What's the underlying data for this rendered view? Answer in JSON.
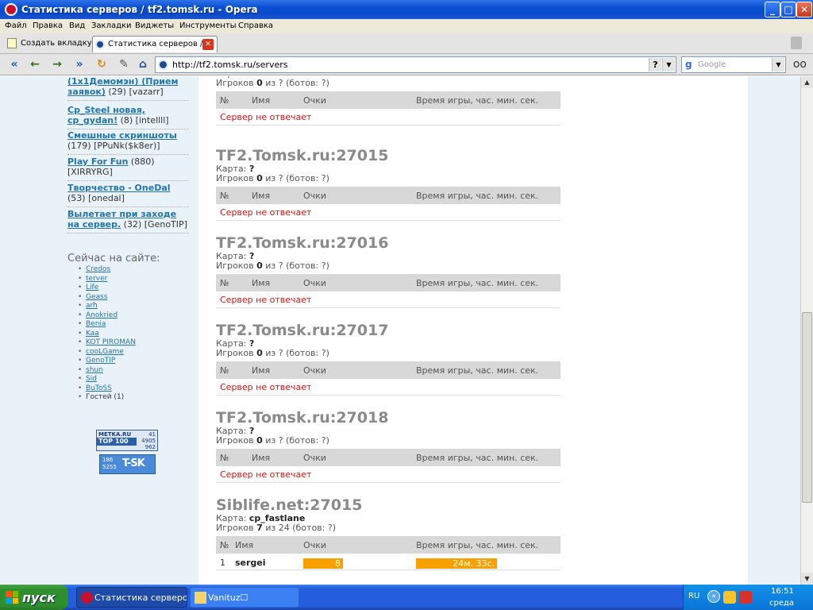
{
  "window": {
    "title": "Статистика серверов / tf2.tomsk.ru - Opera",
    "buttons": {
      "minimize": "_",
      "maximize": "□",
      "close": "✕"
    }
  },
  "menu": [
    "Файл",
    "Правка",
    "Вид",
    "Закладки",
    "Виджеты",
    "Инструменты",
    "Справка"
  ],
  "tabs": {
    "new_tab": "Создать вкладку",
    "active_tab": "Статистика серверов / ...",
    "close_glyph": "✕"
  },
  "toolbar": {
    "url": "http://tf2.tomsk.ru/servers",
    "search_engine": "Google",
    "search_glyph": "g",
    "info_glyph": "?",
    "dropdown_glyph": "▼",
    "glasses_glyph": "oo",
    "nav_glyphs": {
      "rewind": "«",
      "back": "←",
      "forward": "→",
      "fast_forward": "»",
      "reload": "↻",
      "edit": "✎",
      "home": "⌂"
    }
  },
  "sidebar": {
    "forum_items": [
      {
        "title": "(1х1Демомэн) (Прием заявок)",
        "meta": " (29) [vazarr]"
      },
      {
        "title": "Cp_Steel новая, cp_gydan!",
        "meta": " (8) [intellll]"
      },
      {
        "title": "Смешные скриншоты",
        "meta": " (179) [PPuNk($k8er)]"
      },
      {
        "title": "Play For Fun",
        "meta": " (880) [XIRRYRG]"
      },
      {
        "title": "Творчество - OneDal",
        "meta": " (53) [onedal]"
      },
      {
        "title": "Вылетает при заходе на сервер.",
        "meta": " (32) [GenoTIP]"
      }
    ],
    "online_title": "Сейчас на сайте:",
    "online_users": [
      "Credos",
      "terver",
      "Life",
      "Geass",
      "arh",
      "Anokried",
      "Benia",
      "Kaa",
      "KOT PIROMAN",
      "cooLGame",
      "GenoTIP",
      "shun",
      "Sid",
      "BuToSS"
    ],
    "guests": "Гостей (1)",
    "counter1": {
      "site": "METKA.RU",
      "label": "TOP 100",
      "n1": "41",
      "n2": "4905",
      "n3": "962"
    },
    "counter2": {
      "n1": "186",
      "n2": "5255",
      "logo": "T-SK"
    }
  },
  "table_headers": {
    "num": "№",
    "name": "Имя",
    "score": "Очки",
    "time": "Время игры, час. мин. сек."
  },
  "labels": {
    "map": "Карта:",
    "players": "Игроков",
    "of": "из",
    "bots_open": "(ботов:",
    "bots_close": ")"
  },
  "servers": [
    {
      "name": "",
      "map": "?",
      "players": "0",
      "max": "?",
      "bots": "?",
      "status": "Сервер не отвечает"
    },
    {
      "name": "TF2.Tomsk.ru:27015",
      "map": "?",
      "players": "0",
      "max": "?",
      "bots": "?",
      "status": "Сервер не отвечает"
    },
    {
      "name": "TF2.Tomsk.ru:27016",
      "map": "?",
      "players": "0",
      "max": "?",
      "bots": "?",
      "status": "Сервер не отвечает"
    },
    {
      "name": "TF2.Tomsk.ru:27017",
      "map": "?",
      "players": "0",
      "max": "?",
      "bots": "?",
      "status": "Сервер не отвечает"
    },
    {
      "name": "TF2.Tomsk.ru:27018",
      "map": "?",
      "players": "0",
      "max": "?",
      "bots": "?",
      "status": "Сервер не отвечает"
    },
    {
      "name": "Siblife.net:27015",
      "map": "cp_fastlane",
      "players": "7",
      "max": "24",
      "bots": "?",
      "status": ""
    }
  ],
  "siblife_players": [
    {
      "num": "1",
      "name": "sergei",
      "score": "8",
      "time": "24м. 33с."
    }
  ],
  "taskbar": {
    "start": "пуск",
    "items": [
      "Статистика серверов...",
      "Vanituz☐"
    ],
    "lang": "RU",
    "tray_glyph": "«",
    "time": "16:51",
    "day": "среда"
  },
  "scrollbar": {
    "up": "▲",
    "down": "▼"
  }
}
